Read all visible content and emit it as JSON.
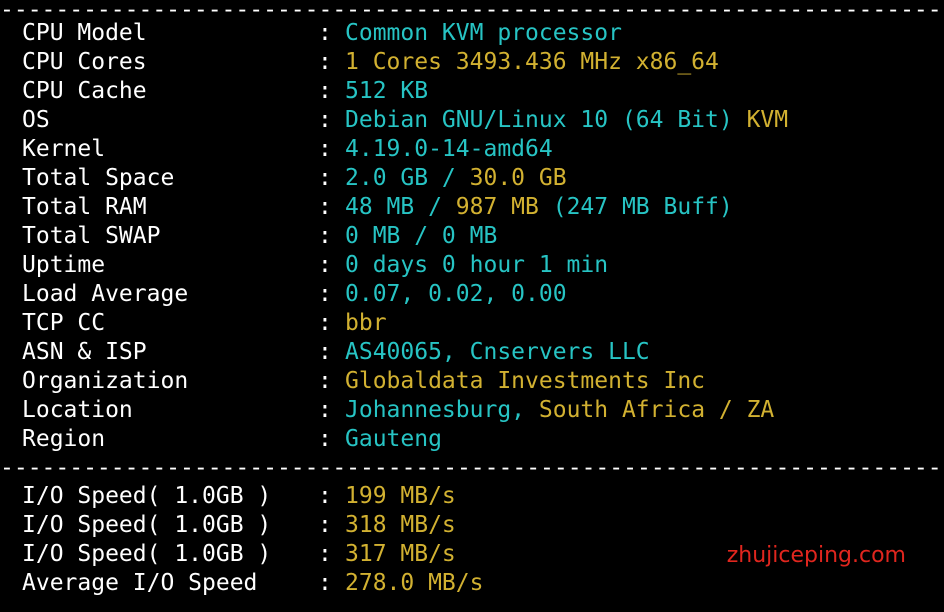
{
  "info_rows": [
    {
      "label": "CPU Model",
      "colon": ":",
      "parts": [
        {
          "text": "Common KVM processor",
          "color": "cyan"
        }
      ]
    },
    {
      "label": "CPU Cores",
      "colon": ":",
      "parts": [
        {
          "text": "1 Cores 3493.436 MHz x86_64",
          "color": "yellow"
        }
      ]
    },
    {
      "label": "CPU Cache",
      "colon": ":",
      "parts": [
        {
          "text": "512 KB",
          "color": "cyan"
        }
      ]
    },
    {
      "label": "OS",
      "colon": ":",
      "parts": [
        {
          "text": "Debian GNU/Linux 10 (64 Bit) ",
          "color": "cyan"
        },
        {
          "text": "KVM",
          "color": "yellow"
        }
      ]
    },
    {
      "label": "Kernel",
      "colon": ":",
      "parts": [
        {
          "text": "4.19.0-14-amd64",
          "color": "cyan"
        }
      ]
    },
    {
      "label": "Total Space",
      "colon": ":",
      "parts": [
        {
          "text": "2.0 GB / ",
          "color": "cyan"
        },
        {
          "text": "30.0 GB",
          "color": "yellow"
        }
      ]
    },
    {
      "label": "Total RAM",
      "colon": ":",
      "parts": [
        {
          "text": "48 MB / ",
          "color": "cyan"
        },
        {
          "text": "987 MB",
          "color": "yellow"
        },
        {
          "text": " (247 MB Buff)",
          "color": "cyan"
        }
      ]
    },
    {
      "label": "Total SWAP",
      "colon": ":",
      "parts": [
        {
          "text": "0 MB / 0 MB",
          "color": "cyan"
        }
      ]
    },
    {
      "label": "Uptime",
      "colon": ":",
      "parts": [
        {
          "text": "0 days 0 hour 1 min",
          "color": "cyan"
        }
      ]
    },
    {
      "label": "Load Average",
      "colon": ":",
      "parts": [
        {
          "text": "0.07, 0.02, 0.00",
          "color": "cyan"
        }
      ]
    },
    {
      "label": "TCP CC",
      "colon": ":",
      "parts": [
        {
          "text": "bbr",
          "color": "yellow"
        }
      ]
    },
    {
      "label": "ASN & ISP",
      "colon": ":",
      "parts": [
        {
          "text": "AS40065, Cnservers LLC",
          "color": "cyan"
        }
      ]
    },
    {
      "label": "Organization",
      "colon": ":",
      "parts": [
        {
          "text": "Globaldata Investments Inc",
          "color": "yellow"
        }
      ]
    },
    {
      "label": "Location",
      "colon": ":",
      "parts": [
        {
          "text": "Johannesburg, ",
          "color": "cyan"
        },
        {
          "text": "South Africa / ZA",
          "color": "yellow"
        }
      ]
    },
    {
      "label": "Region",
      "colon": ":",
      "parts": [
        {
          "text": "Gauteng",
          "color": "cyan"
        }
      ]
    }
  ],
  "divider_text": "-------------------------------------------------------------------------------------",
  "io_rows": [
    {
      "label": "I/O Speed( 1.0GB )",
      "colon": ":",
      "parts": [
        {
          "text": "199 MB/s",
          "color": "yellow"
        }
      ]
    },
    {
      "label": "I/O Speed( 1.0GB )",
      "colon": ":",
      "parts": [
        {
          "text": "318 MB/s",
          "color": "yellow"
        }
      ]
    },
    {
      "label": "I/O Speed( 1.0GB )",
      "colon": ":",
      "parts": [
        {
          "text": "317 MB/s",
          "color": "yellow"
        }
      ]
    },
    {
      "label": "Average I/O Speed",
      "colon": ":",
      "parts": [
        {
          "text": "278.0 MB/s",
          "color": "yellow"
        }
      ]
    }
  ],
  "watermark": "zhujiceping.com",
  "colors": {
    "background": "#000000",
    "label": "#ffffff",
    "cyan": "#27c4c4",
    "yellow": "#d2b131",
    "watermark": "#e0261e"
  }
}
